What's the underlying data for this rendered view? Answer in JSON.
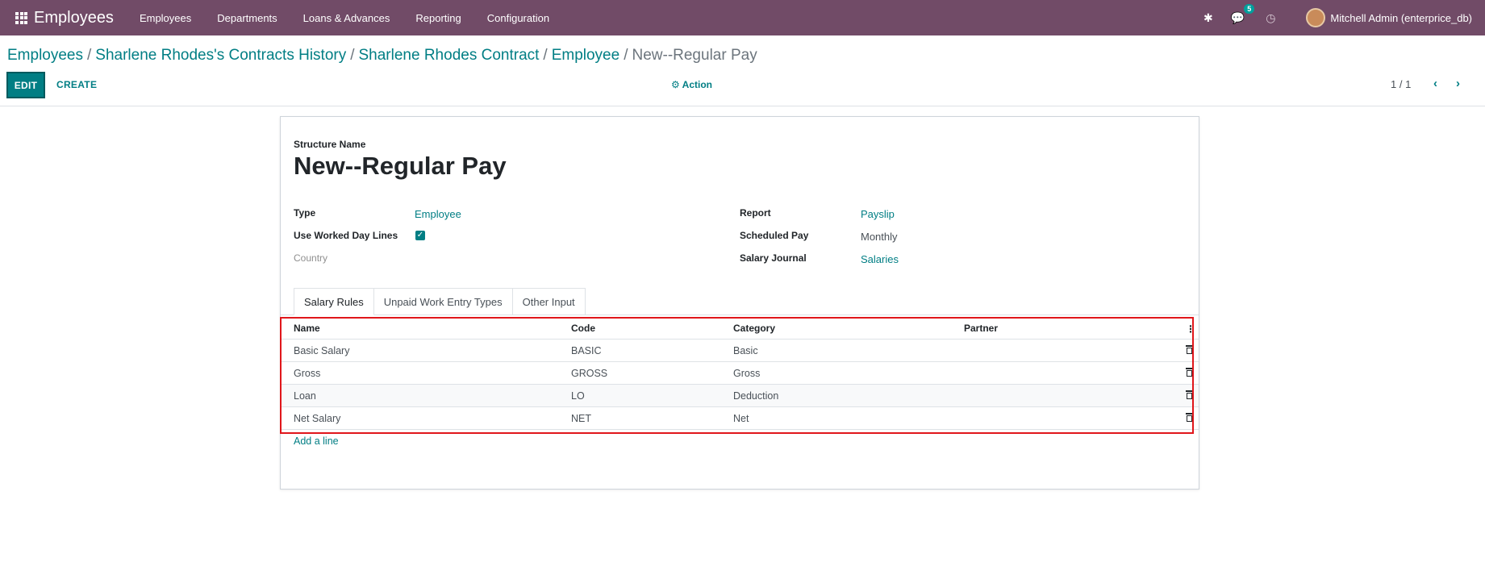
{
  "navbar": {
    "app_title": "Employees",
    "menu": [
      "Employees",
      "Departments",
      "Loans & Advances",
      "Reporting",
      "Configuration"
    ],
    "chat_badge": "5",
    "user": "Mitchell Admin (enterprice_db)",
    "bg_color": "#714B67"
  },
  "breadcrumb": {
    "items": [
      "Employees",
      "Sharlene Rhodes's Contracts History",
      "Sharlene Rhodes Contract",
      "Employee"
    ],
    "current": "New--Regular Pay"
  },
  "toolbar": {
    "edit_label": "EDIT",
    "create_label": "CREATE",
    "action_label": "Action",
    "pager": "1 / 1"
  },
  "form": {
    "structure_name_label": "Structure Name",
    "title": "New--Regular Pay",
    "type_label": "Type",
    "type_value": "Employee",
    "use_worked_label": "Use Worked Day Lines",
    "use_worked_checked": true,
    "country_label": "Country",
    "report_label": "Report",
    "report_value": "Payslip",
    "scheduled_pay_label": "Scheduled Pay",
    "scheduled_pay_value": "Monthly",
    "salary_journal_label": "Salary Journal",
    "salary_journal_value": "Salaries"
  },
  "tabs": [
    "Salary Rules",
    "Unpaid Work Entry Types",
    "Other Input"
  ],
  "table": {
    "columns": {
      "name": "Name",
      "code": "Code",
      "category": "Category",
      "partner": "Partner"
    },
    "rows": [
      {
        "name": "Basic Salary",
        "code": "BASIC",
        "category": "Basic",
        "partner": ""
      },
      {
        "name": "Gross",
        "code": "GROSS",
        "category": "Gross",
        "partner": ""
      },
      {
        "name": "Loan",
        "code": "LO",
        "category": "Deduction",
        "partner": ""
      },
      {
        "name": "Net Salary",
        "code": "NET",
        "category": "Net",
        "partner": ""
      }
    ],
    "add_line": "Add a line"
  },
  "colors": {
    "accent": "#017E84",
    "highlight": "#e0161b"
  }
}
